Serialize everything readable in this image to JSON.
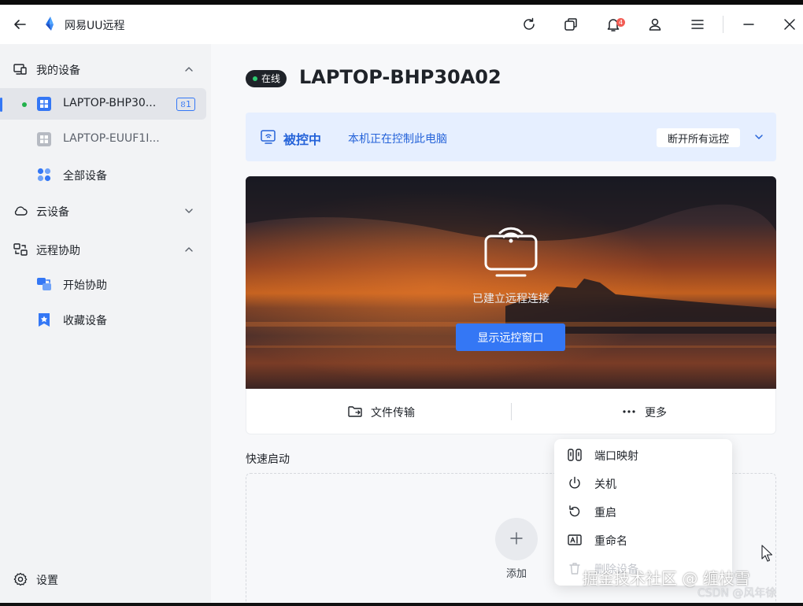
{
  "app": {
    "title": "网易UU远程",
    "notification_count": "4"
  },
  "sidebar": {
    "my_devices": "我的设备",
    "devices": [
      {
        "label": "LAPTOP-BHP30...",
        "badge": "ខ1",
        "active": true
      },
      {
        "label": "LAPTOP-EUUF1I...",
        "active": false
      },
      {
        "label": "全部设备",
        "active": false
      }
    ],
    "cloud_devices": "云设备",
    "remote_assist": "远程协助",
    "assist_items": [
      {
        "label": "开始协助"
      },
      {
        "label": "收藏设备"
      }
    ],
    "settings": "设置"
  },
  "main": {
    "status": "在线",
    "device_name": "LAPTOP-BHP30A02",
    "banner": {
      "title": "被控中",
      "desc": "本机正在控制此电脑",
      "button": "断开所有远控"
    },
    "preview": {
      "status_text": "已建立远程连接",
      "button": "显示远控窗口"
    },
    "actions": {
      "file_transfer": "文件传输",
      "more": "更多"
    },
    "quick_launch": {
      "title": "快速启动",
      "add": "添加"
    }
  },
  "menu": {
    "items": [
      {
        "label": "端口映射",
        "icon": "port-mapping-icon",
        "disabled": false
      },
      {
        "label": "关机",
        "icon": "power-icon",
        "disabled": false
      },
      {
        "label": "重启",
        "icon": "restart-icon",
        "disabled": false
      },
      {
        "label": "重命名",
        "icon": "rename-icon",
        "disabled": false
      },
      {
        "label": "删除设备",
        "icon": "trash-icon",
        "disabled": true
      }
    ]
  },
  "watermark": {
    "line1": "掘金技术社区 @ 缠枝雪",
    "line2": "CSDN @风年徐"
  },
  "colors": {
    "accent": "#3477f5",
    "online": "#22b14c",
    "banner_bg": "#e6efff",
    "sidebar_bg": "#f2f3f5",
    "badge_red": "#f25c54"
  }
}
